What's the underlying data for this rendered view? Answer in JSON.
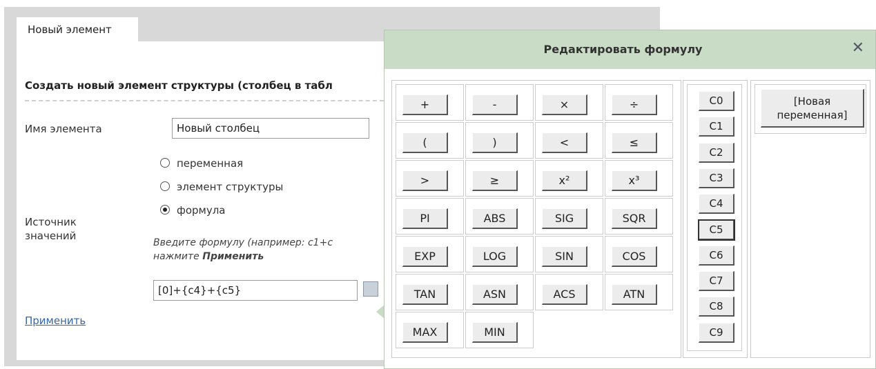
{
  "tab": {
    "label": "Новый элемент"
  },
  "form": {
    "section_title": "Создать новый элемент структуры (столбец в табл",
    "name_label": "Имя элемента",
    "name_value": "Новый столбец",
    "source_label_line1": "Источник",
    "source_label_line2": "значений",
    "radio_variable": "переменная",
    "radio_structure": "элемент структуры",
    "radio_formula": "формула",
    "selected_radio": "формула",
    "hint_line1": "Введите формулу (например: c1+c",
    "hint_line2_prefix": "нажмите ",
    "hint_line2_bold": "Применить",
    "formula_value": "[0]+{c4}+{c5}",
    "apply_link": "Применить"
  },
  "dialog": {
    "title": "Редактировать формулу",
    "close_glyph": "✕",
    "operators": [
      [
        "+",
        "-",
        "×",
        "÷"
      ],
      [
        "(",
        ")",
        "<",
        "≤"
      ],
      [
        ">",
        "≥",
        "x²",
        "x³"
      ],
      [
        "PI",
        "ABS",
        "SIG",
        "SQR"
      ],
      [
        "EXP",
        "LOG",
        "SIN",
        "COS"
      ],
      [
        "TAN",
        "ASN",
        "ACS",
        "ATN"
      ],
      [
        "MAX",
        "MIN"
      ]
    ],
    "columns": [
      "C0",
      "C1",
      "C2",
      "C3",
      "C4",
      "C5",
      "C6",
      "C7",
      "C8",
      "C9"
    ],
    "active_column": "C5",
    "new_variable_line1": "[Новая",
    "new_variable_line2": "переменная]"
  },
  "colors": {
    "dialog_header": "#c9dcc5",
    "link": "#3366aa",
    "background_window": "#d8d8d8"
  }
}
